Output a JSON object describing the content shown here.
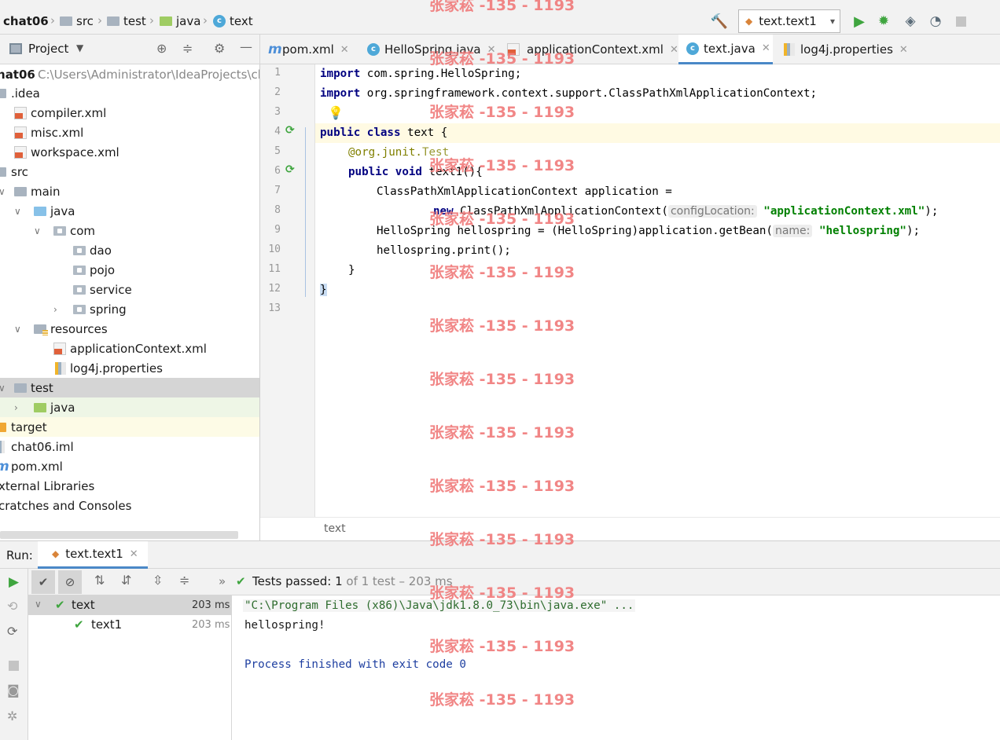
{
  "navbar": {
    "project": "chat06",
    "crumbs": [
      "src",
      "test",
      "java",
      "text"
    ],
    "run_config": "text.text1"
  },
  "project_panel": {
    "title": "Project",
    "root_name": "chat06",
    "root_path": "C:\\Users\\Administrator\\IdeaProjects\\ch",
    "items": [
      {
        "label": ".idea"
      },
      {
        "label": "compiler.xml"
      },
      {
        "label": "misc.xml"
      },
      {
        "label": "workspace.xml"
      },
      {
        "label": "src"
      },
      {
        "label": "main"
      },
      {
        "label": "java"
      },
      {
        "label": "com"
      },
      {
        "label": "dao"
      },
      {
        "label": "pojo"
      },
      {
        "label": "service"
      },
      {
        "label": "spring"
      },
      {
        "label": "resources"
      },
      {
        "label": "applicationContext.xml"
      },
      {
        "label": "log4j.properties"
      },
      {
        "label": "test"
      },
      {
        "label": "java"
      },
      {
        "label": "target"
      },
      {
        "label": "chat06.iml"
      },
      {
        "label": "pom.xml"
      },
      {
        "label": "xternal Libraries"
      },
      {
        "label": "cratches and Consoles"
      }
    ]
  },
  "tabs": [
    {
      "label": "pom.xml"
    },
    {
      "label": "HelloSpring.java"
    },
    {
      "label": "applicationContext.xml"
    },
    {
      "label": "text.java"
    },
    {
      "label": "log4j.properties"
    }
  ],
  "editor": {
    "line_numbers": [
      "1",
      "2",
      "3",
      "4",
      "5",
      "6",
      "7",
      "8",
      "9",
      "10",
      "11",
      "12",
      "13"
    ],
    "code": {
      "l1_kw": "import",
      "l1_rest": " com.spring.HelloSpring;",
      "l2_kw": "import",
      "l2_rest": " org.springframework.context.support.ClassPathXmlApplicationContext;",
      "l4_kw": "public class",
      "l4_rest": " text {",
      "l5_ann": "@org.junit.",
      "l5_test": "Test",
      "l6_kw": "public void",
      "l6_rest": " text1(){",
      "l7": "ClassPathXmlApplicationContext application =",
      "l8_kw": "new",
      "l8_a": " ClassPathXmlApplicationContext(",
      "l8_hint": "configLocation:",
      "l8_str": "\"applicationContext.xml\"",
      "l8_end": ");",
      "l9_a": "HelloSpring hellospring = (HelloSpring)application.getBean(",
      "l9_hint": "name:",
      "l9_str": "\"hellospring\"",
      "l9_end": ");",
      "l10": "hellospring.print();",
      "l11": "}",
      "l12": "}"
    },
    "footer_crumb": "text"
  },
  "run": {
    "label": "Run:",
    "tab": "text.text1",
    "status_prefix": "Tests passed:",
    "status_count": "1",
    "status_suffix": "of 1 test – 203 ms",
    "tests": [
      {
        "name": "text",
        "time": "203 ms"
      },
      {
        "name": "text1",
        "time": "203 ms"
      }
    ],
    "console": [
      "\"C:\\Program Files (x86)\\Java\\jdk1.8.0_73\\bin\\java.exe\" ...",
      "hellospring!",
      "",
      "Process finished with exit code 0"
    ]
  },
  "watermark": "张家菘 -135 - 1193",
  "colors": {
    "accent": "#4a88c7",
    "keyword": "#000080",
    "string": "#008000",
    "annotation": "#808000",
    "watermark": "#f07a7a"
  }
}
